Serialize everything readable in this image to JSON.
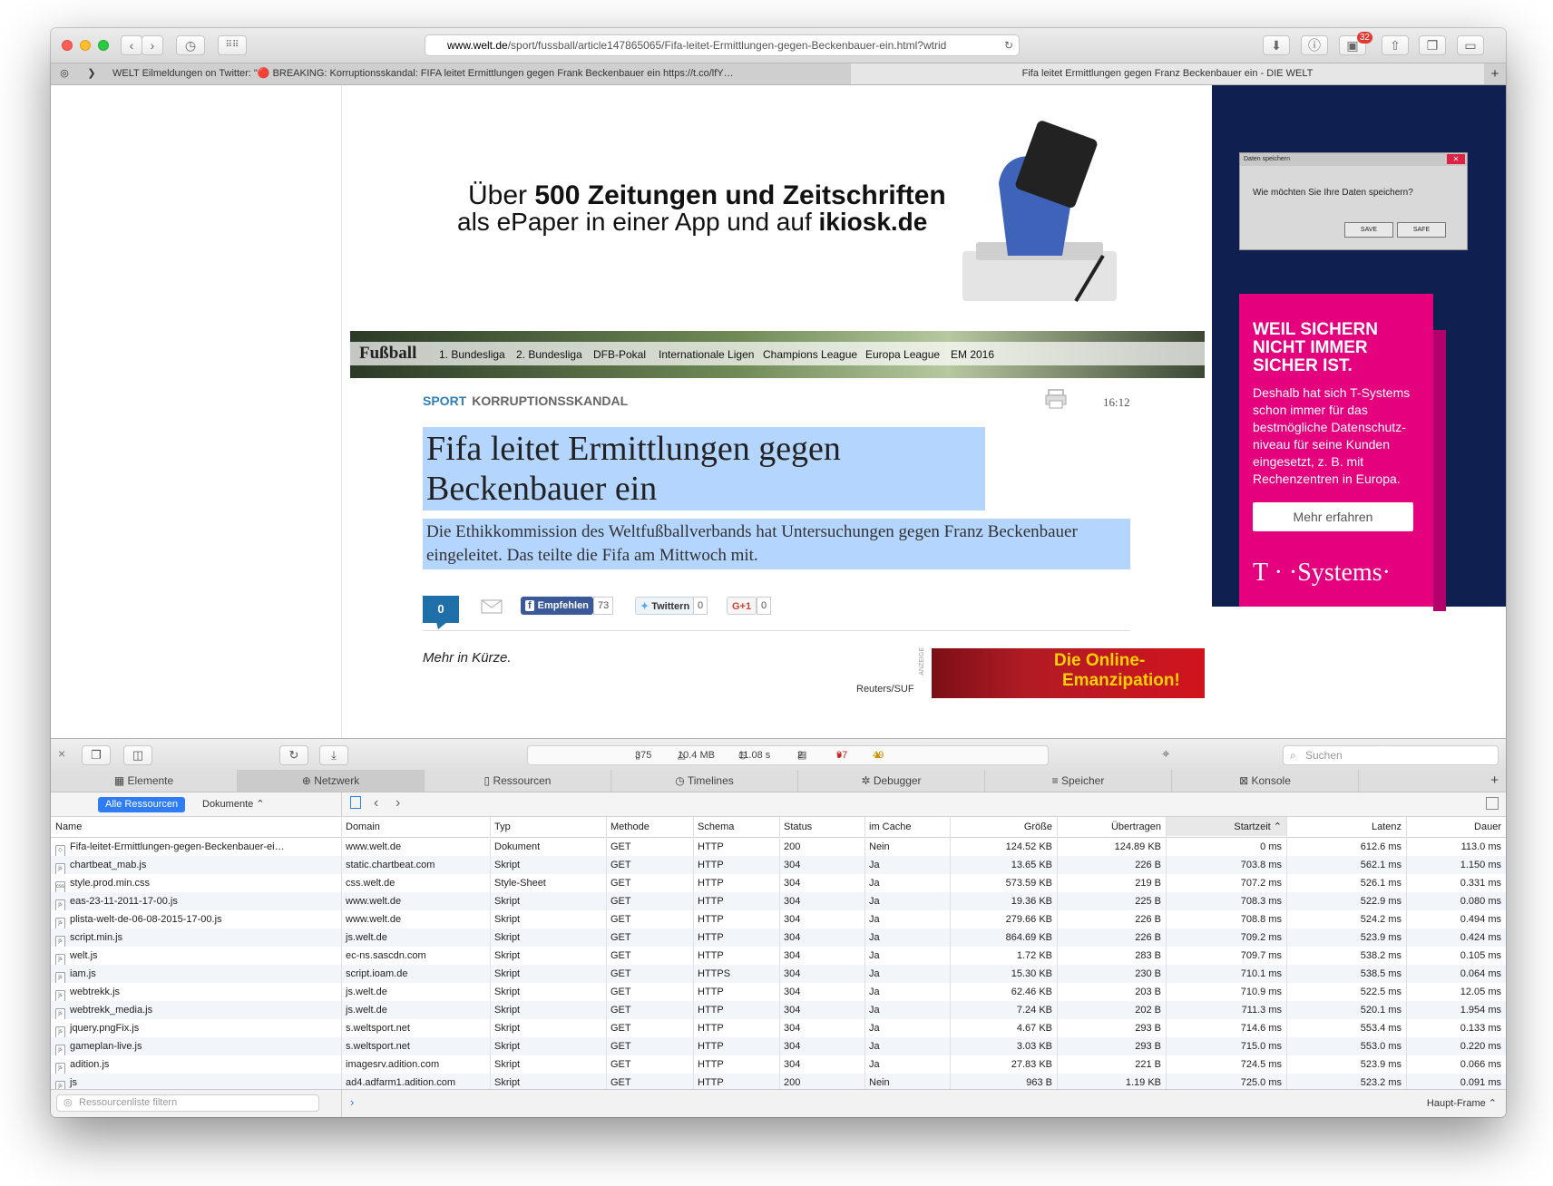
{
  "browser": {
    "url_domain": "www.welt.de",
    "url_path": "/sport/fussball/article147865065/Fifa-leitet-Ermittlungen-gegen-Beckenbauer-ein.html?wtrid",
    "notification_count": "32"
  },
  "tabs": [
    {
      "label": "WELT Eilmeldungen on Twitter: \"🔴 BREAKING: Korruptionsskandal: FIFA leitet Ermittlungen gegen Frank Beckenbauer ein https://t.co/lfY…"
    },
    {
      "label": "Fifa leitet Ermittlungen gegen Franz Beckenbauer ein - DIE WELT"
    }
  ],
  "page": {
    "kiosk_line1_pre": "Über ",
    "kiosk_line1_bold": "500 Zeitungen und Zeitschriften",
    "kiosk_line2_pre": "als ePaper in einer App und auf ",
    "kiosk_line2_bold": "ikiosk.de",
    "section_brand": "Fußball",
    "nav": [
      "1. Bundesliga",
      "2. Bundesliga",
      "DFB-Pokal",
      "Internationale Ligen",
      "Champions League",
      "Europa League",
      "EM 2016"
    ],
    "kicker_section": "SPORT",
    "kicker_topic": "KORRUPTIONSSKANDAL",
    "time": "16:12",
    "headline": "Fifa leitet Ermittlungen gegen Beckenbauer ein",
    "lead": "Die Ethikkommission des Weltfußballverbands hat Untersuchungen gegen Franz Beckenbauer eingeleitet. Das teilte die Fifa am Mittwoch mit.",
    "comment_count": "0",
    "facebook_label": "Empfehlen",
    "facebook_count": "73",
    "twitter_label": "Twittern",
    "twitter_count": "0",
    "gplus_label": "G+1",
    "gplus_count": "0",
    "more_label": "Mehr in Kürze.",
    "photo_credit": "Reuters/SUF",
    "ad_marker": "ANZEIGE",
    "ad_emanz_line1": "Die Online-",
    "ad_emanz_line2": "Emanzipation!"
  },
  "side_ad": {
    "dialog_title": "Daten speichern",
    "dialog_question": "Wie möchten Sie Ihre Daten speichern?",
    "dialog_btn1": "SAVE",
    "dialog_btn2": "SAFE",
    "headline_1": "WEIL SICHERN",
    "headline_2": "NICHT IMMER",
    "headline_3": "SICHER IST.",
    "text": "Deshalb hat sich T-Systems schon immer für das bestmögliche Datenschutz-niveau für seine Kunden eingesetzt, z. B. mit Rechenzentren in Europa.",
    "button": "Mehr erfahren",
    "logo": "T · ·Systems·"
  },
  "devtools": {
    "stats": {
      "requests": "375",
      "size": "10.4 MB",
      "time": "11.08 s",
      "messages": "2",
      "errors": "97",
      "warnings": "49"
    },
    "search_placeholder": "Suchen",
    "tabs": [
      "Elemente",
      "Netzwerk",
      "Ressourcen",
      "Timelines",
      "Debugger",
      "Speicher",
      "Konsole"
    ],
    "filter_all": "Alle Ressourcen",
    "filter_docs": "Dokumente ⌃",
    "columns": [
      "Name",
      "Domain",
      "Typ",
      "Methode",
      "Schema",
      "Status",
      "im Cache",
      "Größe",
      "Übertragen",
      "Startzeit ⌃",
      "Latenz",
      "Dauer"
    ],
    "rows": [
      [
        "Fifa-leitet-Ermittlungen-gegen-Beckenbauer-ei…",
        "www.welt.de",
        "Dokument",
        "GET",
        "HTTP",
        "200",
        "Nein",
        "124.52 KB",
        "124.89 KB",
        "0 ms",
        "612.6 ms",
        "113.0 ms"
      ],
      [
        "chartbeat_mab.js",
        "static.chartbeat.com",
        "Skript",
        "GET",
        "HTTP",
        "304",
        "Ja",
        "13.65 KB",
        "226 B",
        "703.8 ms",
        "562.1 ms",
        "1.150 ms"
      ],
      [
        "style.prod.min.css",
        "css.welt.de",
        "Style-Sheet",
        "GET",
        "HTTP",
        "304",
        "Ja",
        "573.59 KB",
        "219 B",
        "707.2 ms",
        "526.1 ms",
        "0.331 ms"
      ],
      [
        "eas-23-11-2011-17-00.js",
        "www.welt.de",
        "Skript",
        "GET",
        "HTTP",
        "304",
        "Ja",
        "19.36 KB",
        "225 B",
        "708.3 ms",
        "522.9 ms",
        "0.080 ms"
      ],
      [
        "plista-welt-de-06-08-2015-17-00.js",
        "www.welt.de",
        "Skript",
        "GET",
        "HTTP",
        "304",
        "Ja",
        "279.66 KB",
        "226 B",
        "708.8 ms",
        "524.2 ms",
        "0.494 ms"
      ],
      [
        "script.min.js",
        "js.welt.de",
        "Skript",
        "GET",
        "HTTP",
        "304",
        "Ja",
        "864.69 KB",
        "226 B",
        "709.2 ms",
        "523.9 ms",
        "0.424 ms"
      ],
      [
        "welt.js",
        "ec-ns.sascdn.com",
        "Skript",
        "GET",
        "HTTP",
        "304",
        "Ja",
        "1.72 KB",
        "283 B",
        "709.7 ms",
        "538.2 ms",
        "0.105 ms"
      ],
      [
        "iam.js",
        "script.ioam.de",
        "Skript",
        "GET",
        "HTTPS",
        "304",
        "Ja",
        "15.30 KB",
        "230 B",
        "710.1 ms",
        "538.5 ms",
        "0.064 ms"
      ],
      [
        "webtrekk.js",
        "js.welt.de",
        "Skript",
        "GET",
        "HTTP",
        "304",
        "Ja",
        "62.46 KB",
        "203 B",
        "710.9 ms",
        "522.5 ms",
        "12.05 ms"
      ],
      [
        "webtrekk_media.js",
        "js.welt.de",
        "Skript",
        "GET",
        "HTTP",
        "304",
        "Ja",
        "7.24 KB",
        "202 B",
        "711.3 ms",
        "520.1 ms",
        "1.954 ms"
      ],
      [
        "jquery.pngFix.js",
        "s.weltsport.net",
        "Skript",
        "GET",
        "HTTP",
        "304",
        "Ja",
        "4.67 KB",
        "293 B",
        "714.6 ms",
        "553.4 ms",
        "0.133 ms"
      ],
      [
        "gameplan-live.js",
        "s.weltsport.net",
        "Skript",
        "GET",
        "HTTP",
        "304",
        "Ja",
        "3.03 KB",
        "293 B",
        "715.0 ms",
        "553.0 ms",
        "0.220 ms"
      ],
      [
        "adition.js",
        "imagesrv.adition.com",
        "Skript",
        "GET",
        "HTTP",
        "304",
        "Ja",
        "27.83 KB",
        "221 B",
        "724.5 ms",
        "523.9 ms",
        "0.066 ms"
      ],
      [
        "js",
        "ad4.adfarm1.adition.com",
        "Skript",
        "GET",
        "HTTP",
        "200",
        "Nein",
        "963 B",
        "1.19 KB",
        "725.0 ms",
        "523.2 ms",
        "0.091 ms"
      ]
    ],
    "filter_placeholder": "Ressourcenliste filtern",
    "frame_select": "Haupt-Frame ⌃"
  }
}
